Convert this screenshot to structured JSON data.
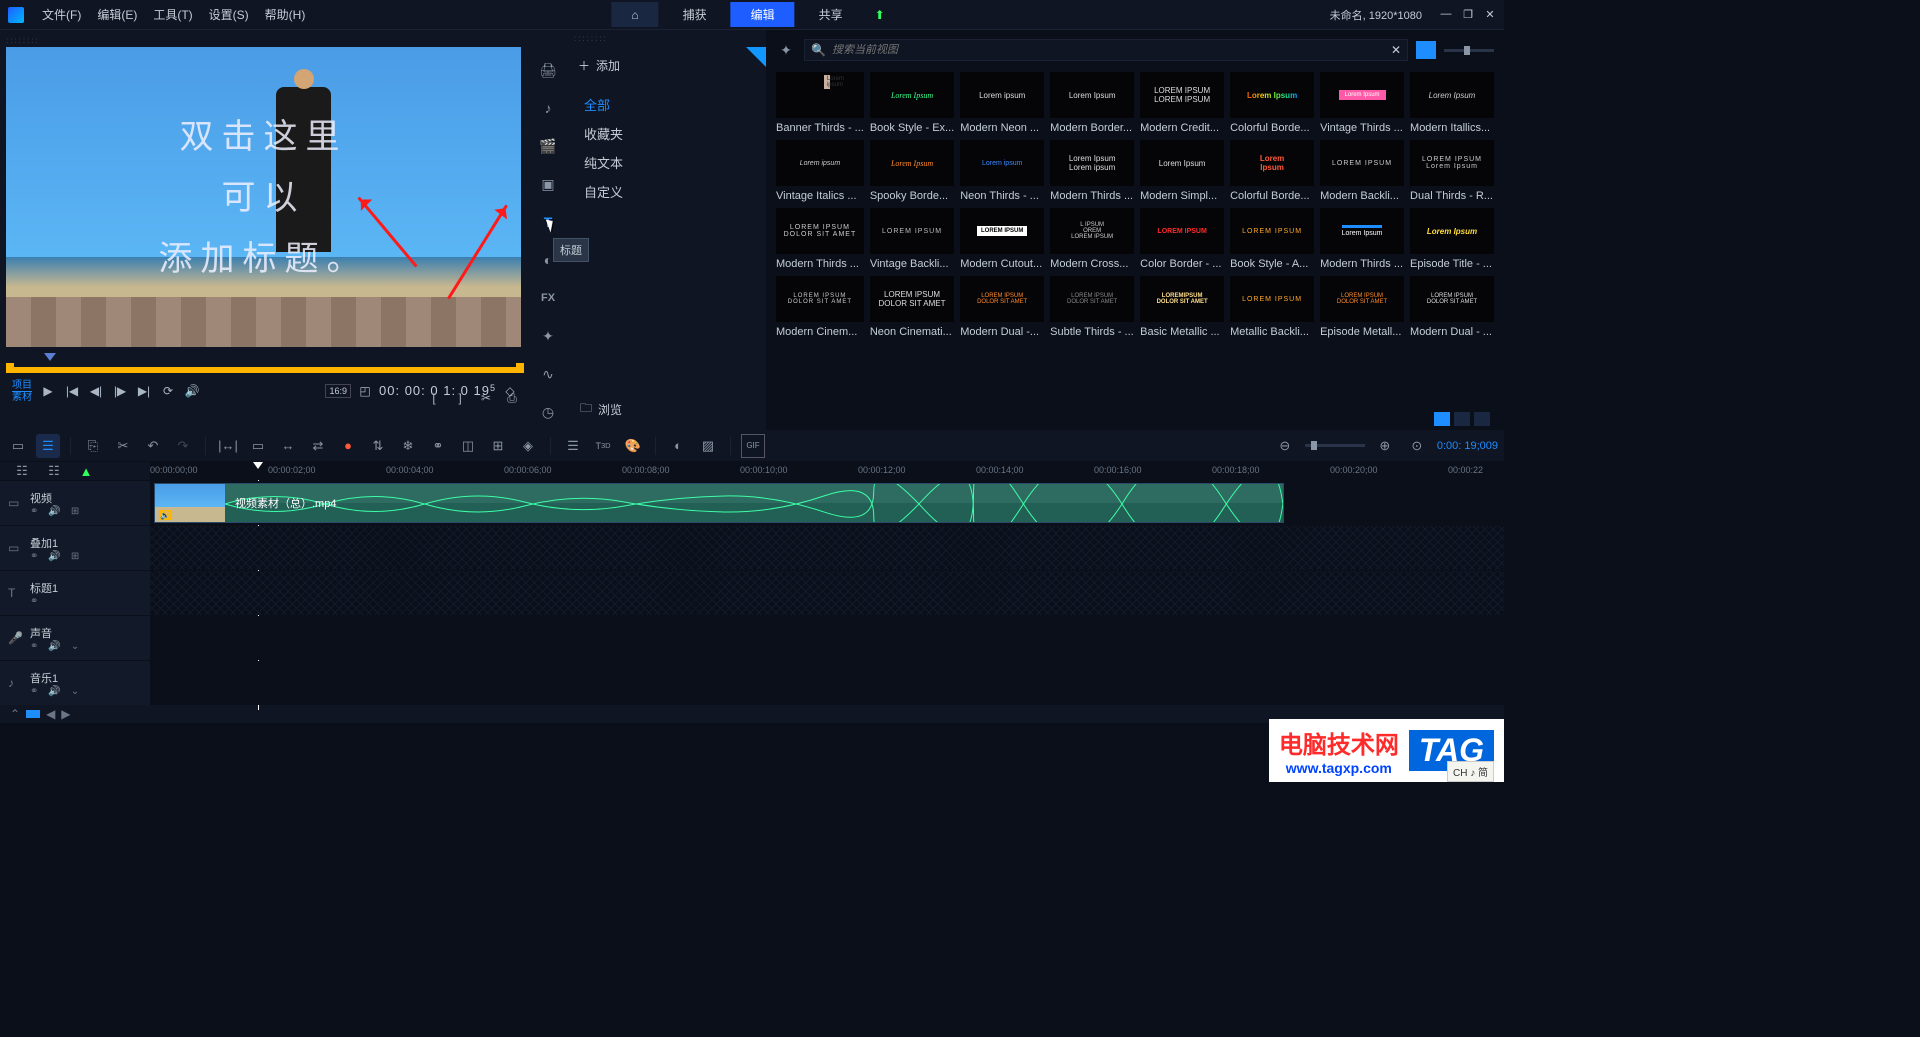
{
  "menubar": {
    "file": "文件(F)",
    "edit": "编辑(E)",
    "tools": "工具(T)",
    "settings": "设置(S)",
    "help": "帮助(H)"
  },
  "modes": {
    "capture": "捕获",
    "edit": "编辑",
    "share": "共享"
  },
  "status": {
    "project": "未命名, 1920*1080"
  },
  "preview": {
    "title_line1": "双击这里",
    "title_line2": "可以",
    "title_line3": "添加标题。",
    "tab_project": "项目",
    "tab_media": "素材",
    "timecode": "00: 00: 0 1: 0 19",
    "timecode_sub": "5",
    "ratio": "16:9"
  },
  "tooltip": "标题",
  "sidebar": {
    "add": "添加",
    "categories": [
      "全部",
      "收藏夹",
      "纯文本",
      "自定义"
    ],
    "browse": "浏览"
  },
  "search": {
    "placeholder": "搜索当前视图"
  },
  "assets": [
    {
      "label": "Banner Thirds - ...",
      "t": "Lorem ipsum",
      "s": "banner"
    },
    {
      "label": "Book Style - Ex...",
      "t": "Lorem Ipsum",
      "s": "green-script"
    },
    {
      "label": "Modern Neon ...",
      "t": "Lorem ipsum",
      "s": "plain"
    },
    {
      "label": "Modern Border...",
      "t": "Lorem Ipsum",
      "s": "plain"
    },
    {
      "label": "Modern Credit...",
      "t": "LOREM IPSUM\\nLOREM IPSUM",
      "s": "plain"
    },
    {
      "label": "Colorful Borde...",
      "t": "Lorem Ipsum",
      "s": "rainbow"
    },
    {
      "label": "Vintage Thirds ...",
      "t": "Lorem Ipsum",
      "s": "pink-bar"
    },
    {
      "label": "Modern Itallics...",
      "t": "Lorem Ipsum",
      "s": "italic"
    },
    {
      "label": "Vintage Italics ...",
      "t": "Lorem ipsum",
      "s": "italic-small"
    },
    {
      "label": "Spooky Borde...",
      "t": "Lorem Ipsum",
      "s": "orange-script"
    },
    {
      "label": "Neon Thirds - ...",
      "t": "Lorem ipsum",
      "s": "blue-small"
    },
    {
      "label": "Modern Thirds ...",
      "t": "Lorem Ipsum\\nLorem ipsum",
      "s": "plain"
    },
    {
      "label": "Modern Simpl...",
      "t": "Lorem Ipsum",
      "s": "plain"
    },
    {
      "label": "Colorful Borde...",
      "t": "Lorem\\nIpsum",
      "s": "colorful"
    },
    {
      "label": "Modern Backli...",
      "t": "LOREM IPSUM",
      "s": "caps"
    },
    {
      "label": "Dual Thirds - R...",
      "t": "LOREM IPSUM\\nLorem Ipsum",
      "s": "caps"
    },
    {
      "label": "Modern Thirds ...",
      "t": "LOREM IPSUM\\nDOLOR SIT AMET",
      "s": "caps"
    },
    {
      "label": "Vintage Backli...",
      "t": "LOREM IPSUM",
      "s": "vintage"
    },
    {
      "label": "Modern Cutout...",
      "t": "LOREM IPSUM",
      "s": "white-box"
    },
    {
      "label": "Modern Cross...",
      "t": "L IPSUM\\nOREM\\nLOREM IPSUM",
      "s": "stack"
    },
    {
      "label": "Color Border - ...",
      "t": "LOREM IPSUM",
      "s": "red-caps"
    },
    {
      "label": "Book Style - A...",
      "t": "LOREM IPSUM",
      "s": "orange-caps"
    },
    {
      "label": "Modern Thirds ...",
      "t": "Lorem Ipsum",
      "s": "blue-bar"
    },
    {
      "label": "Episode Title - ...",
      "t": "Lorem Ipsum",
      "s": "badge"
    },
    {
      "label": "Modern Cinem...",
      "t": "LOREM IPSUM\\nDOLOR SIT AMET",
      "s": "cinema"
    },
    {
      "label": "Neon Cinemati...",
      "t": "LOREM IPSUM\\nDOLOR SIT AMET",
      "s": "plain"
    },
    {
      "label": "Modern Dual -...",
      "t": "LOREM IPSUM\\nDOLOR SIT AMET",
      "s": "orange-dual"
    },
    {
      "label": "Subtle Thirds - ...",
      "t": "LOREM IPSUM\\nDOLOR SIT AMET",
      "s": "subtle"
    },
    {
      "label": "Basic Metallic ...",
      "t": "LOREMIPSUM\\nDOLOR SIT AMET",
      "s": "metallic"
    },
    {
      "label": "Metallic Backli...",
      "t": "LOREM IPSUM",
      "s": "orange-caps"
    },
    {
      "label": "Episode Metall...",
      "t": "LOREM IPSUM\\nDOLOR SIT AMET",
      "s": "orange-dual"
    },
    {
      "label": "Modern Dual - ...",
      "t": "LOREM IPSUM\\nDOLOR SIT AMET",
      "s": "modern"
    }
  ],
  "timeline": {
    "ruler": [
      "00:00:00;00",
      "00:00:02;00",
      "00:00:04;00",
      "00:00:06;00",
      "00:00:08;00",
      "00:00:10;00",
      "00:00:12;00",
      "00:00:14;00",
      "00:00:16;00",
      "00:00:18;00",
      "00:00:20;00",
      "00:00:22"
    ],
    "duration_tc": "0:00: 19;009",
    "clip_name": "视频素材（总）.mp4",
    "tracks": {
      "video": "视频",
      "overlay1": "叠加1",
      "title1": "标题1",
      "voice": "声音",
      "music1": "音乐1"
    }
  },
  "ime": "CH ♪ 简",
  "watermark": {
    "title": "电脑技术网",
    "url": "www.tagxp.com",
    "tag": "TAG"
  }
}
